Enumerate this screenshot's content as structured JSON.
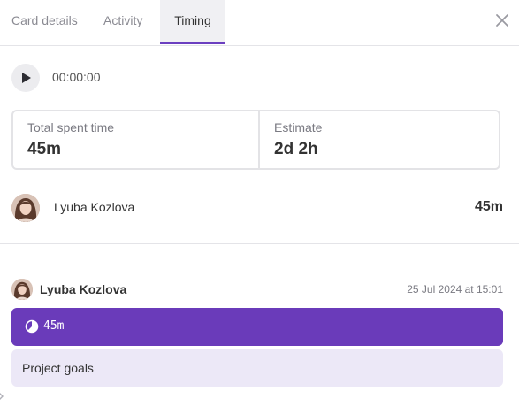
{
  "tabs": [
    {
      "label": "Card details",
      "active": false
    },
    {
      "label": "Activity",
      "active": false
    },
    {
      "label": "Timing",
      "active": true
    }
  ],
  "icons": {
    "close": "close-icon",
    "play": "play-icon",
    "timer": "timer-icon"
  },
  "colors": {
    "accent": "#6a3bba",
    "note_background": "#ece8f7",
    "tab_active_background": "#f0f0f3"
  },
  "timer": {
    "value": "00:00:00"
  },
  "stats": {
    "total_label": "Total spent time",
    "total_value": "45m",
    "estimate_label": "Estimate",
    "estimate_value": "2d 2h"
  },
  "users": [
    {
      "name": "Lyuba Kozlova",
      "time": "45m"
    }
  ],
  "entries": [
    {
      "user": "Lyuba Kozlova",
      "date": "25 Jul 2024 at 15:01",
      "duration": "45m",
      "note": "Project goals"
    }
  ]
}
